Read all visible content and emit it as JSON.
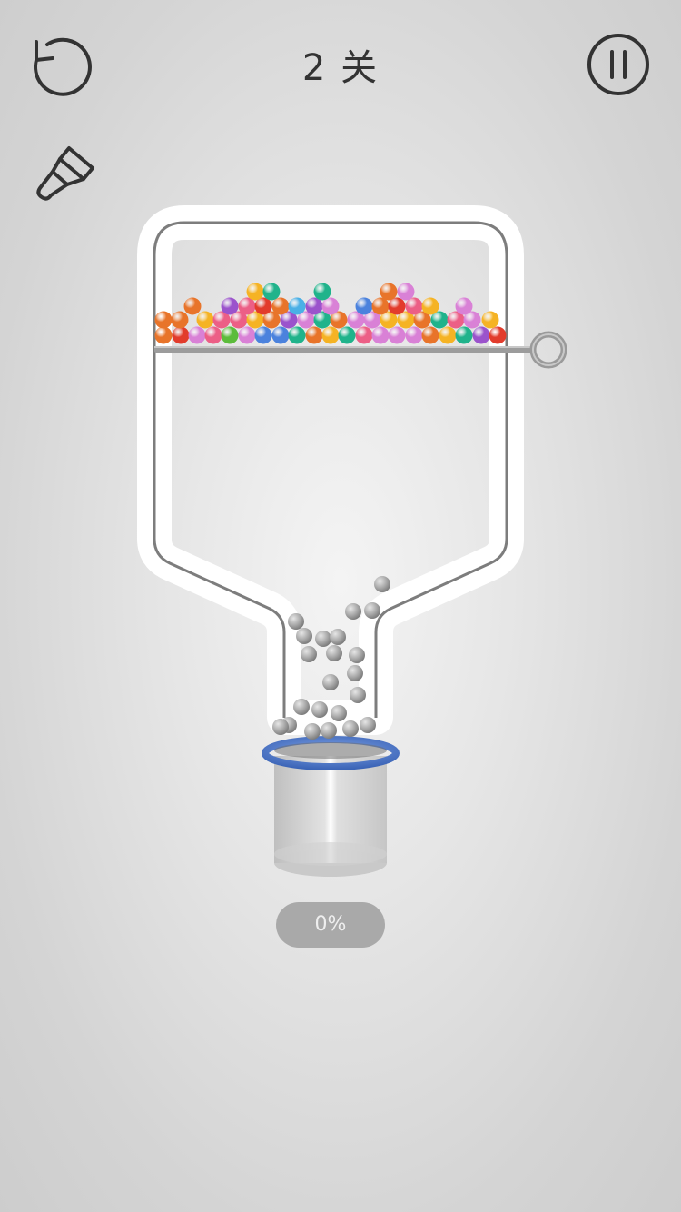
{
  "header": {
    "level_text": "2 关",
    "restart_icon": "restart-icon",
    "pause_icon": "pause-icon",
    "brush_icon": "paintbrush-icon"
  },
  "progress": {
    "text": "0%",
    "fill_percent": 0
  },
  "colors": {
    "bottle_outline": "#ffffff",
    "bottle_inner_stroke": "#7a7a7a",
    "pin": "#9a9a9a",
    "cup_rim": "#4a74c7",
    "gray_ball": "#a5a5a5",
    "ball_palette": {
      "orange": "#e8742a",
      "red": "#e23c2c",
      "pink": "#ec5f86",
      "violet": "#d981d6",
      "purple": "#9b53cc",
      "yellow": "#f5b324",
      "blue": "#4b82dd",
      "teal": "#20b38b",
      "green": "#5cbc3b",
      "lightblue": "#4ab0e6"
    }
  },
  "colored_balls": {
    "row_1": [
      "orange",
      "red",
      "violet",
      "pink",
      "green",
      "violet",
      "blue",
      "blue",
      "teal",
      "orange",
      "yellow",
      "teal",
      "pink",
      "violet",
      "violet",
      "violet",
      "orange",
      "yellow",
      "teal",
      "purple",
      "red"
    ],
    "row_2": [
      "orange",
      "orange",
      "yellow",
      "pink",
      "pink",
      "yellow",
      "orange",
      "purple",
      "violet",
      "teal",
      "orange",
      "violet",
      "violet",
      "yellow",
      "yellow",
      "orange",
      "teal",
      "pink",
      "violet",
      "yellow"
    ],
    "row_3": [
      "orange",
      "purple",
      "pink",
      "red",
      "orange",
      "lightblue",
      "purple",
      "violet",
      "blue",
      "orange",
      "red",
      "pink",
      "yellow",
      "violet"
    ],
    "row_4": [
      "yellow",
      "teal",
      "teal",
      "orange",
      "violet"
    ]
  },
  "gray_ball_count": 22
}
